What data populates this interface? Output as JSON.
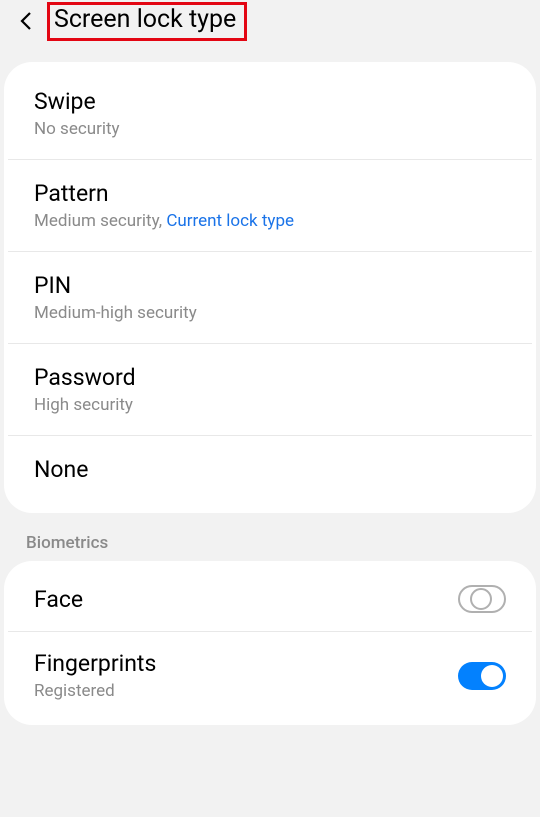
{
  "header": {
    "title": "Screen lock type"
  },
  "lockTypes": [
    {
      "title": "Swipe",
      "subtitle": "No security",
      "current": ""
    },
    {
      "title": "Pattern",
      "subtitle": "Medium security, ",
      "current": "Current lock type"
    },
    {
      "title": "PIN",
      "subtitle": "Medium-high security",
      "current": ""
    },
    {
      "title": "Password",
      "subtitle": "High security",
      "current": ""
    },
    {
      "title": "None",
      "subtitle": "",
      "current": ""
    }
  ],
  "biometricsHeader": "Biometrics",
  "biometrics": [
    {
      "title": "Face",
      "subtitle": "",
      "enabled": false
    },
    {
      "title": "Fingerprints",
      "subtitle": "Registered",
      "enabled": true
    }
  ]
}
